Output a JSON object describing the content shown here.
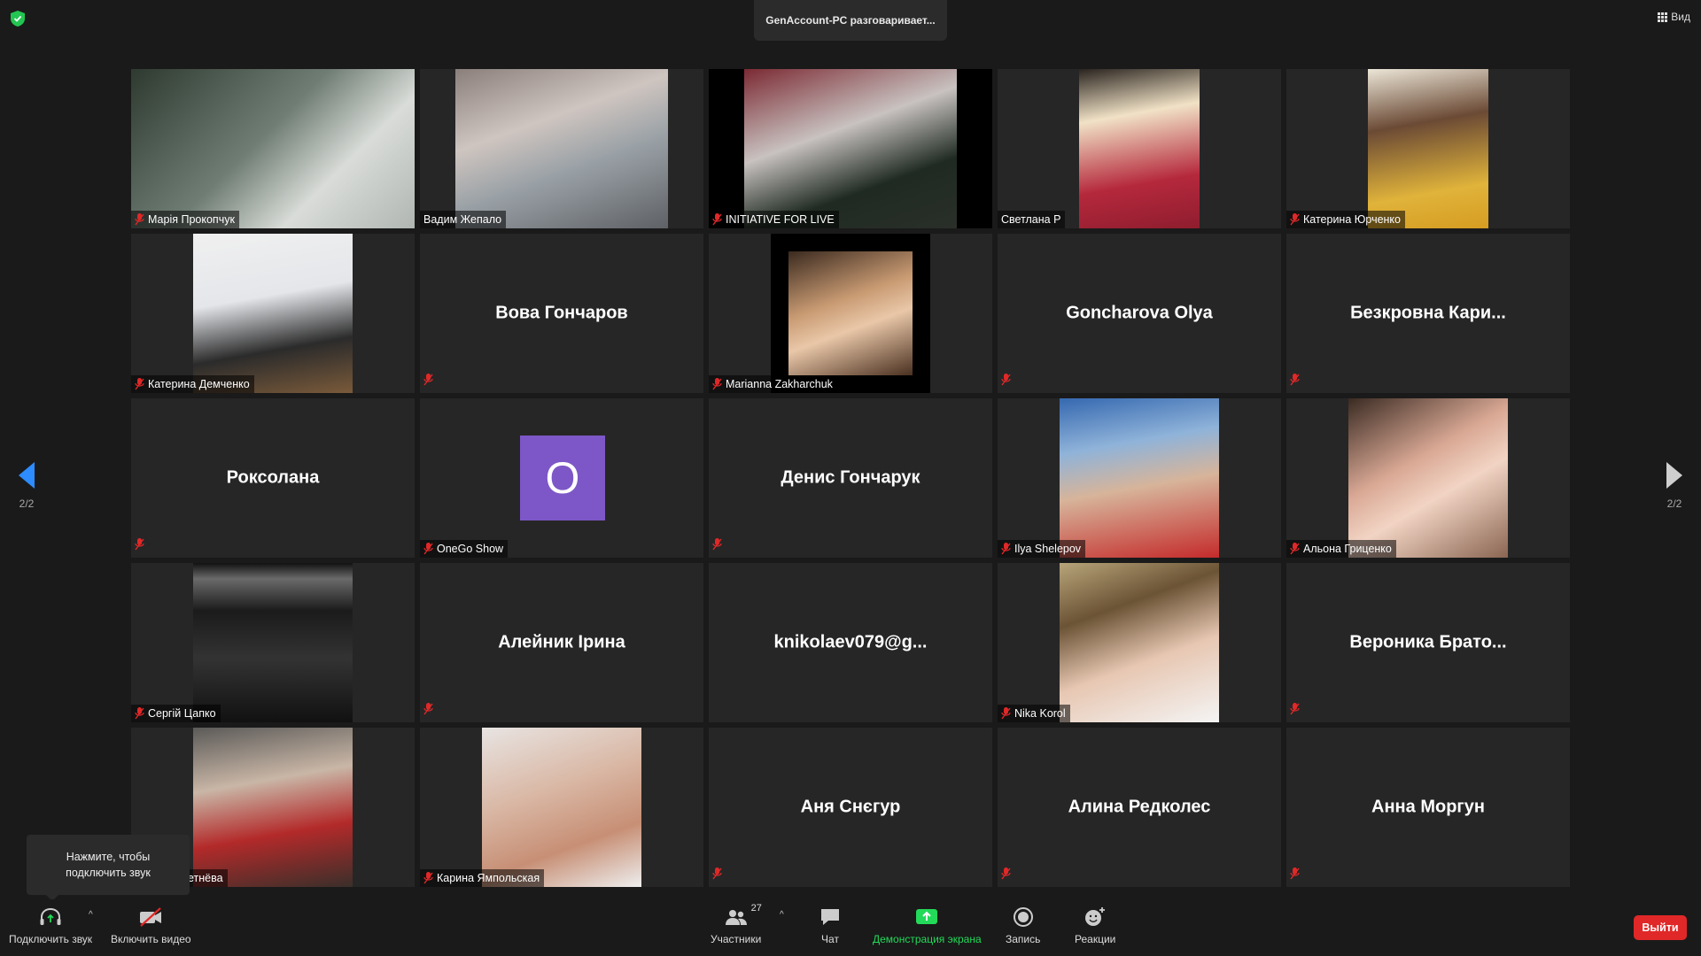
{
  "header": {
    "active_speaker": "GenAccount-PC разговаривает...",
    "view_label": "Вид"
  },
  "paging": {
    "left_count": "2/2",
    "right_count": "2/2"
  },
  "tooltip": {
    "text_line1": "Нажмите, чтобы",
    "text_line2": "подключить звук"
  },
  "tiles": [
    {
      "name": "Марія Прокопчук",
      "type": "video"
    },
    {
      "name": "Вадим Жепало",
      "type": "video"
    },
    {
      "name": "INITIATIVE FOR LIVE",
      "type": "video"
    },
    {
      "name": "Светлана Р",
      "type": "video"
    },
    {
      "name": "Катерина Юрченко",
      "type": "video"
    },
    {
      "name": "Катерина Демченко",
      "type": "video"
    },
    {
      "name": "Вова Гончаров",
      "type": "name"
    },
    {
      "name": "Marianna Zakharchuk",
      "type": "video"
    },
    {
      "name": "Goncharova Olya",
      "type": "name"
    },
    {
      "name": "Безкровна  Кари...",
      "type": "name"
    },
    {
      "name": "Роксолана",
      "type": "name"
    },
    {
      "name": "OneGo Show",
      "type": "avatar",
      "avatar_letter": "O",
      "avatar_color": "#7d57c7"
    },
    {
      "name": "Денис Гончарук",
      "type": "name"
    },
    {
      "name": "Ilya Shelepov",
      "type": "video"
    },
    {
      "name": "Альона Гриценко",
      "type": "video"
    },
    {
      "name": "Сергій Цапко",
      "type": "video"
    },
    {
      "name": "Алейник Ірина",
      "type": "name"
    },
    {
      "name": "knikolaev079@g...",
      "type": "name"
    },
    {
      "name": "Nika Korol",
      "type": "video"
    },
    {
      "name": "Вероника  Брато...",
      "type": "name"
    },
    {
      "name": "етнёва",
      "type": "video"
    },
    {
      "name": "Карина Ямпольская",
      "type": "video"
    },
    {
      "name": "Аня Снєгур",
      "type": "name"
    },
    {
      "name": "Алина Редколес",
      "type": "name"
    },
    {
      "name": "Анна Моргун",
      "type": "name"
    }
  ],
  "toolbar": {
    "join_audio": "Подключить звук",
    "start_video": "Включить видео",
    "participants": "Участники",
    "participants_count": "27",
    "chat": "Чат",
    "share_screen": "Демонстрация экрана",
    "record": "Запись",
    "reactions": "Реакции",
    "leave": "Выйти"
  },
  "colors": {
    "accent": "#2d8cff",
    "share": "#23d959",
    "leave": "#e02828",
    "muted": "#e02828"
  }
}
